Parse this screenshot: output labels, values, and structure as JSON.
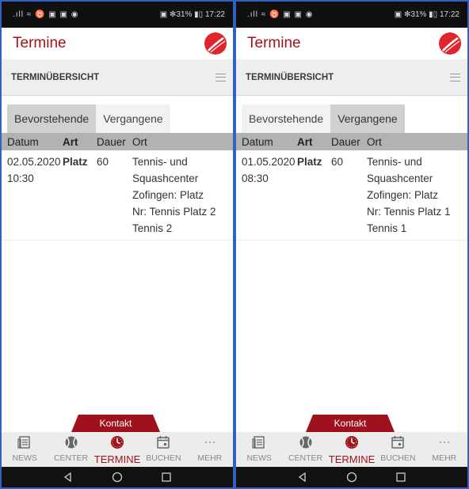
{
  "screens": [
    {
      "status": {
        "left": ".ıll ≈ ♉ ▣ ▣ ◉",
        "right": "▣ ✻31% ▮▯ 17:22"
      },
      "app_title": "Termine",
      "section_title": "TERMINÜBERSICHT",
      "tabs": [
        {
          "label": "Bevorstehende",
          "active": true
        },
        {
          "label": "Vergangene",
          "active": false
        }
      ],
      "columns": {
        "datum": "Datum",
        "art": "Art",
        "dauer": "Dauer",
        "ort": "Ort"
      },
      "rows": [
        {
          "datum": "02.05.2020\n10:30",
          "art": "Platz",
          "dauer": "60",
          "ort": "Tennis- und\nSquashcenter\nZofingen: Platz\nNr: Tennis Platz 2\nTennis 2"
        }
      ],
      "kontakt": "Kontakt",
      "nav": [
        {
          "label": "NEWS",
          "icon": "news-icon"
        },
        {
          "label": "CENTER",
          "icon": "tennis-ball-icon"
        },
        {
          "label": "TERMINE",
          "icon": "clock-icon",
          "active": true
        },
        {
          "label": "BUCHEN",
          "icon": "calendar-icon"
        },
        {
          "label": "MEHR",
          "icon": "more-dots-icon"
        }
      ]
    },
    {
      "status": {
        "left": ".ıll ≈ ♉ ▣ ▣ ◉",
        "right": "▣ ✻31% ▮▯ 17:22"
      },
      "app_title": "Termine",
      "section_title": "TERMINÜBERSICHT",
      "tabs": [
        {
          "label": "Bevorstehende",
          "active": false
        },
        {
          "label": "Vergangene",
          "active": true
        }
      ],
      "columns": {
        "datum": "Datum",
        "art": "Art",
        "dauer": "Dauer",
        "ort": "Ort"
      },
      "rows": [
        {
          "datum": "01.05.2020\n08:30",
          "art": "Platz",
          "dauer": "60",
          "ort": "Tennis- und\nSquashcenter\nZofingen: Platz\nNr: Tennis Platz 1\nTennis 1"
        }
      ],
      "kontakt": "Kontakt",
      "nav": [
        {
          "label": "NEWS",
          "icon": "news-icon"
        },
        {
          "label": "CENTER",
          "icon": "tennis-ball-icon"
        },
        {
          "label": "TERMINE",
          "icon": "clock-icon",
          "active": true
        },
        {
          "label": "BUCHEN",
          "icon": "calendar-icon"
        },
        {
          "label": "MEHR",
          "icon": "more-dots-icon"
        }
      ]
    }
  ],
  "colors": {
    "brand": "#a3121c",
    "tab_active": "#d0d0d0",
    "header_row": "#b2b2b2",
    "frame": "#2f62c4"
  }
}
